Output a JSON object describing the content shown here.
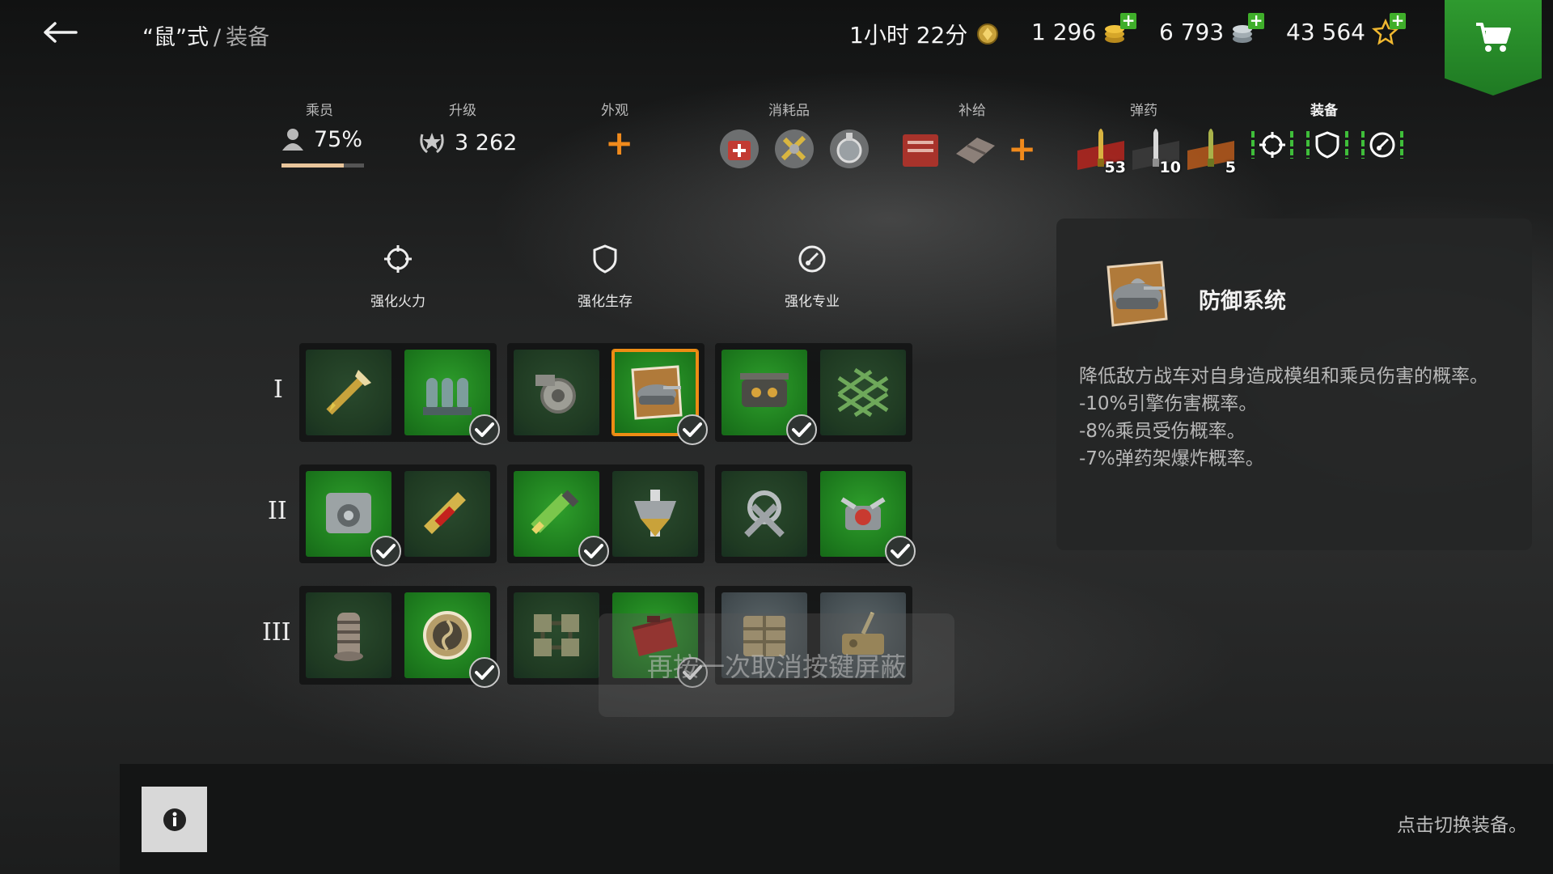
{
  "header": {
    "back_icon": "arrow-left-icon",
    "breadcrumb_vehicle": "“鼠”式",
    "breadcrumb_sep": "/",
    "breadcrumb_current": "装备"
  },
  "currencies": [
    {
      "value": "1小时 22分",
      "icon": "premium-time-icon"
    },
    {
      "value": "1 296",
      "icon": "gold-coins-icon"
    },
    {
      "value": "6 793",
      "icon": "silver-coins-icon"
    },
    {
      "value": "43 564",
      "icon": "experience-star-icon"
    }
  ],
  "cart": {
    "icon": "shopping-cart-icon"
  },
  "categories": {
    "crew": {
      "label": "乘员",
      "value": "75%",
      "progress": 0.75
    },
    "upgrade": {
      "label": "升级",
      "value": "3 262"
    },
    "camo": {
      "label": "外观",
      "action": "+"
    },
    "consumables": {
      "label": "消耗品",
      "icons": [
        "medkit-icon",
        "repair-kit-icon",
        "fire-extinguisher-icon"
      ]
    },
    "supplies": {
      "label": "补给",
      "icons": [
        "ration-crate-icon",
        "bandage-pack-icon"
      ],
      "action": "+"
    },
    "ammo": {
      "label": "弹药",
      "items": [
        {
          "count": "53"
        },
        {
          "count": "10"
        },
        {
          "count": "5"
        }
      ]
    },
    "equipment": {
      "label": "装备",
      "icons": [
        "crosshair-icon",
        "shield-icon",
        "gauge-icon"
      ]
    }
  },
  "grid": {
    "columns": [
      {
        "label": "强化火力",
        "icon": "crosshair-icon"
      },
      {
        "label": "强化生存",
        "icon": "shield-icon"
      },
      {
        "label": "强化专业",
        "icon": "gauge-icon"
      }
    ],
    "tiers": [
      "I",
      "II",
      "III"
    ],
    "rows": [
      [
        {
          "icon": "shell-rammer-icon",
          "state": "off",
          "installed": false
        },
        {
          "icon": "ammo-rack-icon",
          "state": "on",
          "installed": true
        },
        {
          "icon": "engine-gear-icon",
          "state": "off",
          "installed": false
        },
        {
          "icon": "defense-system-icon",
          "state": "on",
          "installed": true,
          "selected": true
        },
        {
          "icon": "optics-icon",
          "state": "on",
          "installed": true
        },
        {
          "icon": "camo-net-icon",
          "state": "off",
          "installed": false
        }
      ],
      [
        {
          "icon": "loader-mechanism-icon",
          "state": "on",
          "installed": true
        },
        {
          "icon": "ap-shell-icon",
          "state": "off",
          "installed": false
        },
        {
          "icon": "spall-liner-icon",
          "state": "on",
          "installed": true
        },
        {
          "icon": "armor-plate-icon",
          "state": "off",
          "installed": false
        },
        {
          "icon": "tools-crossed-icon",
          "state": "off",
          "installed": false
        },
        {
          "icon": "engine-boost-icon",
          "state": "on",
          "installed": true
        }
      ],
      [
        {
          "icon": "stabilizer-icon",
          "state": "off",
          "installed": false
        },
        {
          "icon": "turbo-fan-icon",
          "state": "on",
          "installed": true
        },
        {
          "icon": "track-links-icon",
          "state": "off",
          "installed": false
        },
        {
          "icon": "toolbox-icon",
          "state": "on",
          "installed": true
        },
        {
          "icon": "supply-crate-icon",
          "state": "gray",
          "installed": false
        },
        {
          "icon": "radio-kit-icon",
          "state": "gray",
          "installed": false
        }
      ]
    ]
  },
  "info_panel": {
    "title": "防御系统",
    "icon": "defense-system-icon",
    "description_lines": [
      "降低敌方战车对自身造成模组和乘员伤害的概率。",
      "-10%引擎伤害概率。",
      "-8%乘员受伤概率。",
      "-7%弹药架爆炸概率。"
    ]
  },
  "toast": {
    "text": "再按一次取消按键屏蔽"
  },
  "footer": {
    "info_icon": "info-icon",
    "hint": "点击切换装备。"
  },
  "colors": {
    "accent_green": "#2f9f2c",
    "selected_border": "#ee8c14",
    "plus_orange": "#f08a1c"
  }
}
